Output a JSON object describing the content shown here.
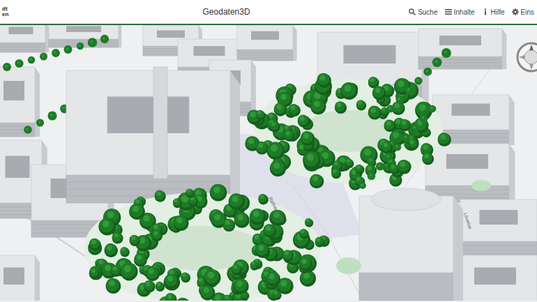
{
  "header": {
    "logo": [
      "dt",
      "en"
    ],
    "title": "Geodaten3D",
    "menu": [
      {
        "label": "Suche"
      },
      {
        "label": "Inhalte"
      },
      {
        "label": "Hilfe"
      },
      {
        "label": "Eins"
      }
    ]
  },
  "map": {
    "labels": [
      {
        "text": "Rathausplatz"
      },
      {
        "text": "Löwelstr"
      }
    ]
  }
}
